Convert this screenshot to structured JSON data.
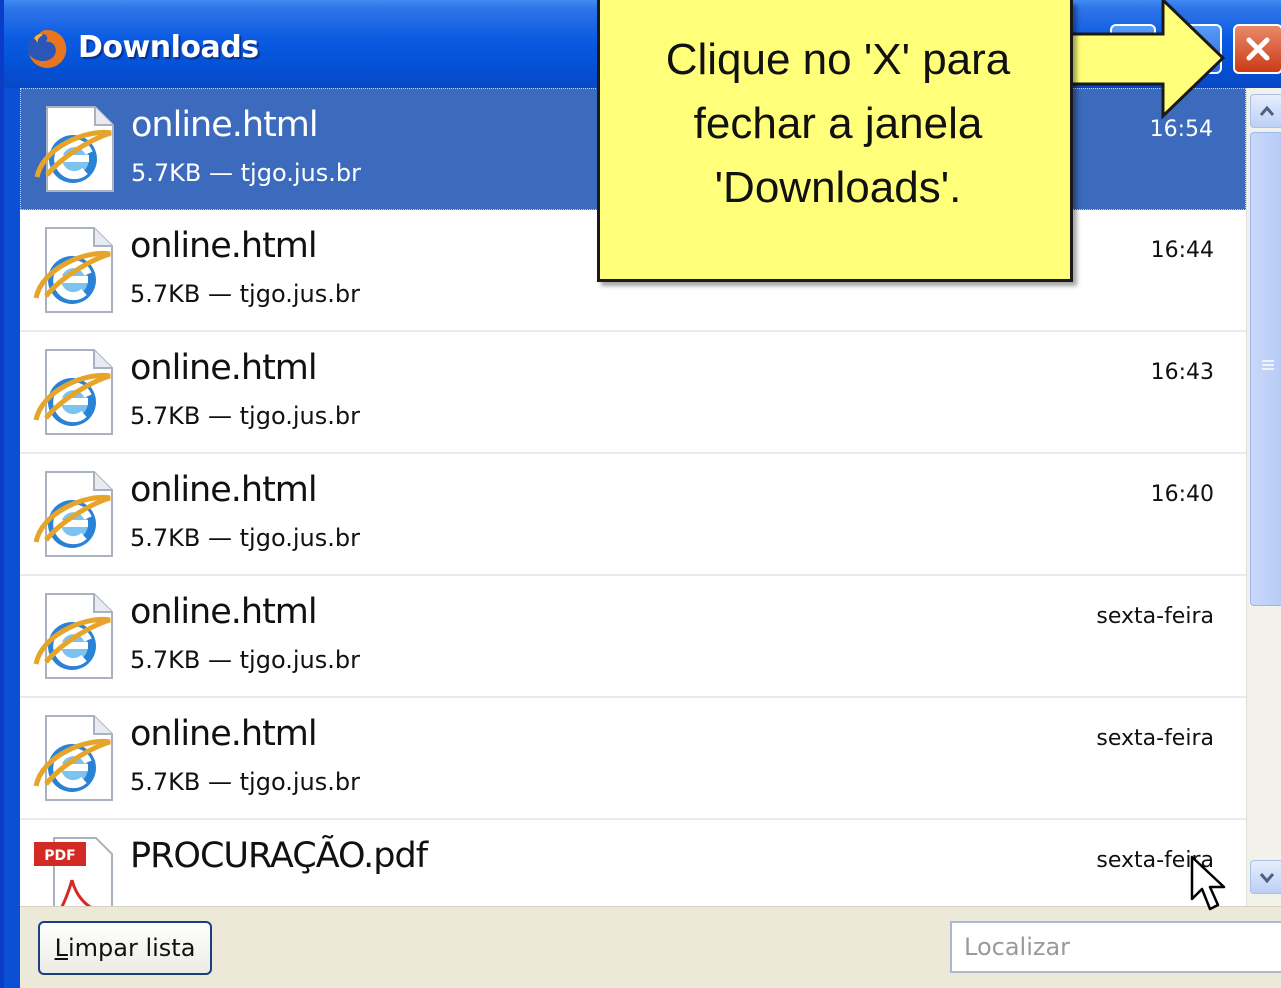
{
  "window": {
    "title": "Downloads",
    "icon": "firefox-icon",
    "controls": [
      "minimize-icon",
      "maximize-icon",
      "close-icon"
    ]
  },
  "downloads": [
    {
      "name": "online.html",
      "info": "5.7KB — tjgo.jus.br",
      "time": "16:54",
      "icon": "ie-file-icon",
      "selected": true
    },
    {
      "name": "online.html",
      "info": "5.7KB — tjgo.jus.br",
      "time": "16:44",
      "icon": "ie-file-icon"
    },
    {
      "name": "online.html",
      "info": "5.7KB — tjgo.jus.br",
      "time": "16:43",
      "icon": "ie-file-icon"
    },
    {
      "name": "online.html",
      "info": "5.7KB — tjgo.jus.br",
      "time": "16:40",
      "icon": "ie-file-icon"
    },
    {
      "name": "online.html",
      "info": "5.7KB — tjgo.jus.br",
      "time": "sexta-feira",
      "icon": "ie-file-icon"
    },
    {
      "name": "online.html",
      "info": "5.7KB — tjgo.jus.br",
      "time": "sexta-feira",
      "icon": "ie-file-icon"
    },
    {
      "name": "PROCURAÇÃO.pdf",
      "info": "",
      "time": "sexta-feira",
      "icon": "pdf-file-icon"
    }
  ],
  "footer": {
    "clear_label": "Limpar lista",
    "clear_accesskey": "L",
    "clear_rest": "impar lista",
    "search_placeholder": "Localizar"
  },
  "callout": {
    "text": "Clique no 'X' para fechar a janela 'Downloads'."
  },
  "colors": {
    "title_bar": "#0453D8",
    "selection": "#3C6ABC",
    "close_button": "#CC3A16",
    "callout": "#FFFF7A"
  }
}
